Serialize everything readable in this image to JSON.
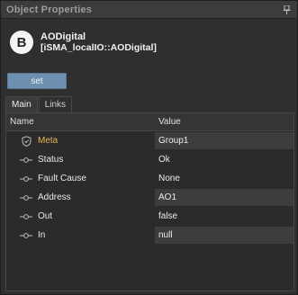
{
  "window": {
    "title": "Object Properties"
  },
  "header": {
    "badge": "B",
    "name": "AODigital",
    "type": "[iSMA_localIO::AODigital]"
  },
  "actions": {
    "set_label": "set"
  },
  "tabs": [
    {
      "label": "Main",
      "active": true
    },
    {
      "label": "Links",
      "active": false
    }
  ],
  "table": {
    "columns": [
      "Name",
      "Value"
    ],
    "rows": [
      {
        "name": "Meta",
        "value": "Group1",
        "icon": "shield-icon"
      },
      {
        "name": "Status",
        "value": "Ok",
        "icon": "slot-icon"
      },
      {
        "name": "Fault Cause",
        "value": "None",
        "icon": "slot-icon"
      },
      {
        "name": "Address",
        "value": "AO1",
        "icon": "slot-icon"
      },
      {
        "name": "Out",
        "value": "false",
        "icon": "slot-icon"
      },
      {
        "name": "In",
        "value": "null",
        "icon": "slot-icon"
      }
    ]
  },
  "colors": {
    "accent": "#6d8fb0",
    "meta": "#e2b35a",
    "background": "#2f2f2f"
  }
}
